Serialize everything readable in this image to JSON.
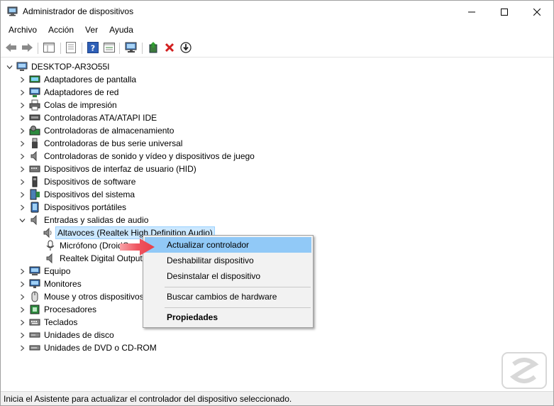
{
  "window": {
    "title": "Administrador de dispositivos"
  },
  "menu": [
    "Archivo",
    "Acción",
    "Ver",
    "Ayuda"
  ],
  "toolbar_icons": [
    "back-icon",
    "forward-icon",
    "show-hide-icon",
    "properties-icon",
    "help-icon",
    "view-icon",
    "monitor-icon",
    "update-driver-icon",
    "uninstall-icon",
    "download-icon"
  ],
  "tree": {
    "root": "DESKTOP-AR3O55I",
    "items": [
      {
        "label": "Adaptadores de pantalla",
        "icon": "display-adapter-icon"
      },
      {
        "label": "Adaptadores de red",
        "icon": "network-adapter-icon"
      },
      {
        "label": "Colas de impresión",
        "icon": "printer-icon"
      },
      {
        "label": "Controladoras ATA/ATAPI IDE",
        "icon": "ide-controller-icon"
      },
      {
        "label": "Controladoras de almacenamiento",
        "icon": "storage-controller-icon"
      },
      {
        "label": "Controladoras de bus serie universal",
        "icon": "usb-icon"
      },
      {
        "label": "Controladoras de sonido y vídeo y dispositivos de juego",
        "icon": "sound-icon"
      },
      {
        "label": "Dispositivos de interfaz de usuario (HID)",
        "icon": "hid-icon"
      },
      {
        "label": "Dispositivos de software",
        "icon": "software-device-icon"
      },
      {
        "label": "Dispositivos del sistema",
        "icon": "system-device-icon"
      },
      {
        "label": "Dispositivos portátiles",
        "icon": "portable-device-icon"
      },
      {
        "label": "Entradas y salidas de audio",
        "icon": "audio-io-icon"
      }
    ],
    "audio_children": [
      "Altavoces (Realtek High Definition Audio)",
      "Micrófono (DroidCam",
      "Realtek Digital Output"
    ],
    "items_after": [
      {
        "label": "Equipo",
        "icon": "computer-icon"
      },
      {
        "label": "Monitores",
        "icon": "monitor-icon"
      },
      {
        "label": "Mouse y otros dispositivos",
        "icon": "mouse-icon"
      },
      {
        "label": "Procesadores",
        "icon": "processor-icon"
      },
      {
        "label": "Teclados",
        "icon": "keyboard-icon"
      },
      {
        "label": "Unidades de disco",
        "icon": "disk-drive-icon"
      },
      {
        "label": "Unidades de DVD o CD-ROM",
        "icon": "dvd-drive-icon"
      }
    ]
  },
  "context_menu": {
    "update": "Actualizar controlador",
    "disable": "Deshabilitar dispositivo",
    "uninstall": "Desinstalar el dispositivo",
    "scan": "Buscar cambios de hardware",
    "properties": "Propiedades"
  },
  "status": "Inicia el Asistente para actualizar el controlador del dispositivo seleccionado.",
  "colors": {
    "selection": "#cce8ff",
    "menu_highlight": "#91c9f7",
    "arrow": "#e8404a"
  }
}
